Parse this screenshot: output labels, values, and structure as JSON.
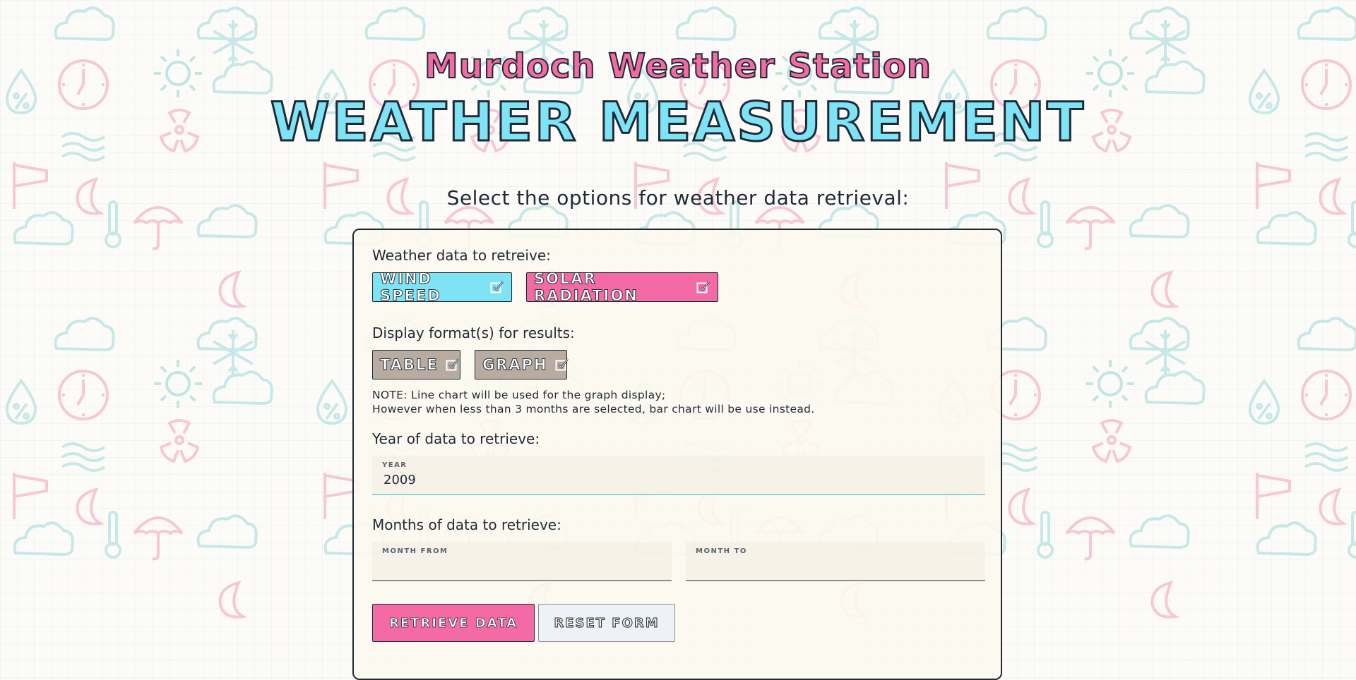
{
  "header": {
    "station_name": "Murdoch Weather Station",
    "title": "WEATHER MEASUREMENT"
  },
  "form": {
    "prompt": "Select the options for weather data retrieval:",
    "data_label": "Weather data to retreive:",
    "data_options": [
      {
        "label": "WIND SPEED",
        "checked": true,
        "color": "#7ee3f5"
      },
      {
        "label": "SOLAR RADIATION",
        "checked": true,
        "color": "#f36aa4"
      }
    ],
    "format_label": "Display format(s) for results:",
    "format_options": [
      {
        "label": "TABLE",
        "checked": true,
        "color": "#b8aca0"
      },
      {
        "label": "GRAPH",
        "checked": true,
        "color": "#b8aca0"
      }
    ],
    "note_line1": "NOTE: Line chart will be used for the graph display;",
    "note_line2": "However when less than 3 months are selected, bar chart will be use instead.",
    "year_label": "Year of data to retrieve:",
    "year_field": {
      "label": "YEAR",
      "value": "2009"
    },
    "months_label": "Months of data to retrieve:",
    "month_from": {
      "label": "MONTH FROM",
      "value": ""
    },
    "month_to": {
      "label": "MONTH TO",
      "value": ""
    },
    "retrieve_button": "RETRIEVE DATA",
    "reset_button": "RESET FORM"
  },
  "colors": {
    "pink": "#f36aa4",
    "cyan": "#7ee3f5",
    "tan": "#b8aca0",
    "ink": "#1f2a36"
  }
}
